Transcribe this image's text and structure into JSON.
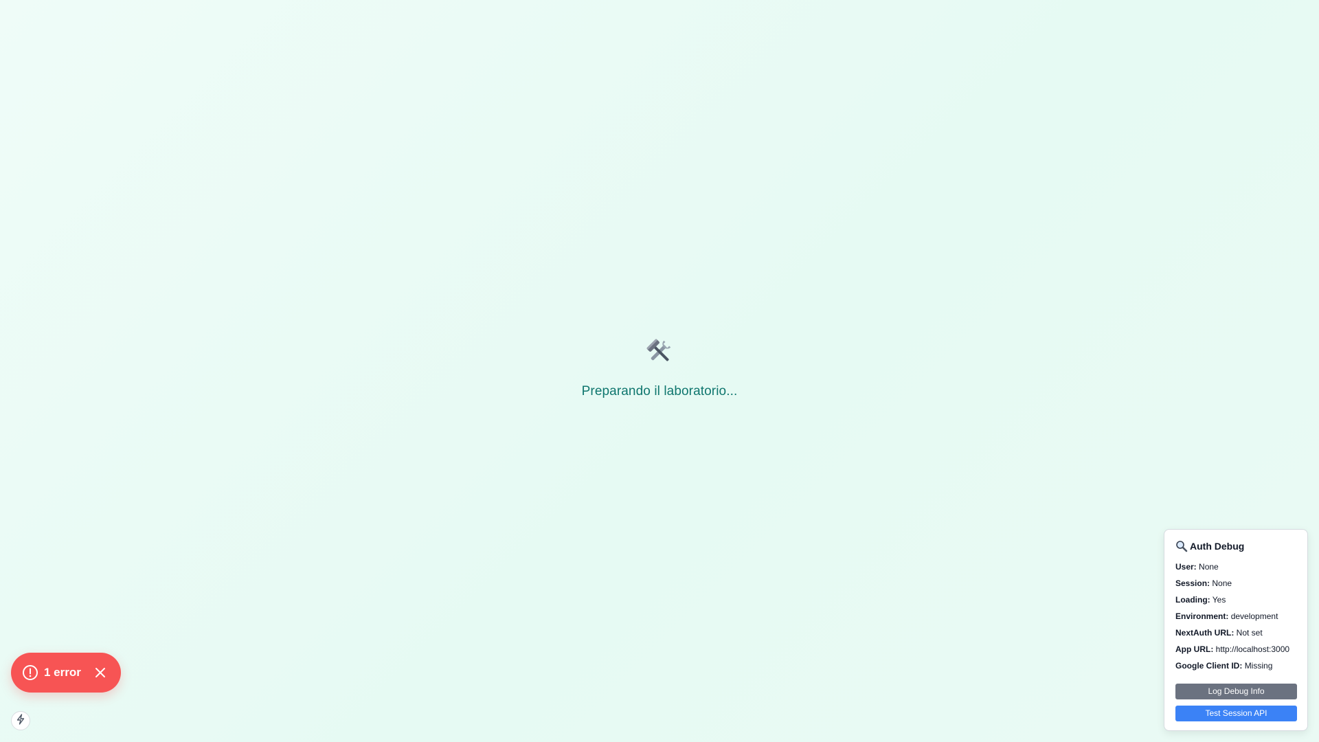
{
  "loading": {
    "icon": "hammer-and-wrench-icon",
    "icon_glyph": "🛠️",
    "message": "Preparando il laboratorio...",
    "message_color": "#0f766e"
  },
  "debug": {
    "title": "Auth Debug",
    "title_icon": "magnifier-icon",
    "rows": [
      {
        "key": "User:",
        "value": "None"
      },
      {
        "key": "Session:",
        "value": "None"
      },
      {
        "key": "Loading:",
        "value": "Yes"
      },
      {
        "key": "Environment:",
        "value": "development"
      },
      {
        "key": "NextAuth URL:",
        "value": "Not set"
      },
      {
        "key": "App URL:",
        "value": "http://localhost:3000"
      },
      {
        "key": "Google Client ID:",
        "value": "Missing"
      }
    ],
    "log_button": "Log Debug Info",
    "test_button": "Test Session API",
    "log_button_color": "#6b7280",
    "test_button_color": "#3b82f6"
  },
  "error_toast": {
    "label": "1 error",
    "icon": "alert-circle-icon",
    "close_icon": "close-icon",
    "color": "#f75454"
  },
  "dev_badge": {
    "icon": "lightning-bolt-icon"
  }
}
